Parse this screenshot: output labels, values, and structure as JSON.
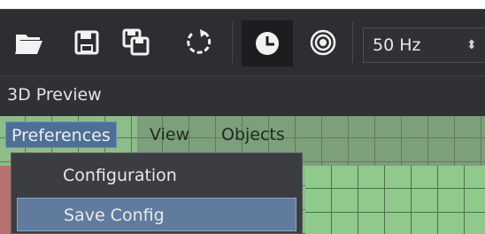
{
  "toolbar": {
    "buttons": [
      {
        "name": "open-folder-icon"
      },
      {
        "name": "save-icon"
      },
      {
        "name": "save-all-icon"
      },
      {
        "name": "reset-rotate-icon"
      },
      {
        "name": "clock-icon"
      },
      {
        "name": "target-icon"
      }
    ],
    "frequency_select": {
      "value": "50 Hz"
    }
  },
  "panel": {
    "title": "3D Preview"
  },
  "menubar": {
    "items": [
      {
        "label": "Preferences"
      },
      {
        "label": "View"
      },
      {
        "label": "Objects"
      }
    ]
  },
  "preferences_menu": {
    "items": [
      {
        "label": "Configuration"
      },
      {
        "label": "Save Config"
      }
    ]
  }
}
